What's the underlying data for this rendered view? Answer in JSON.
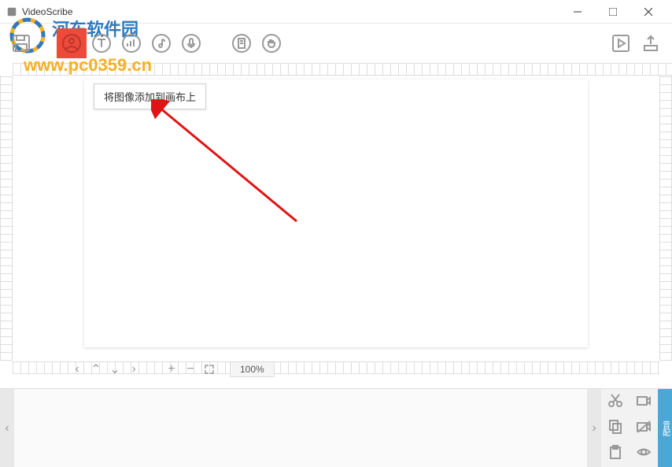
{
  "window": {
    "title": "VideoScribe"
  },
  "toolbar": {
    "tooltip": "将图像添加到画布上"
  },
  "zoom": {
    "value": "100%"
  },
  "watermark": {
    "line1": "河东软件园",
    "line2": "www.pc0359.cn"
  },
  "timeline": {
    "tab_label": "音配"
  },
  "icons": {
    "save": "save-icon",
    "image": "image-icon",
    "text": "text-icon",
    "chart": "chart-icon",
    "music": "music-icon",
    "mic": "mic-icon",
    "page": "page-icon",
    "hand": "hand-icon",
    "play": "play-icon",
    "export": "export-icon"
  }
}
